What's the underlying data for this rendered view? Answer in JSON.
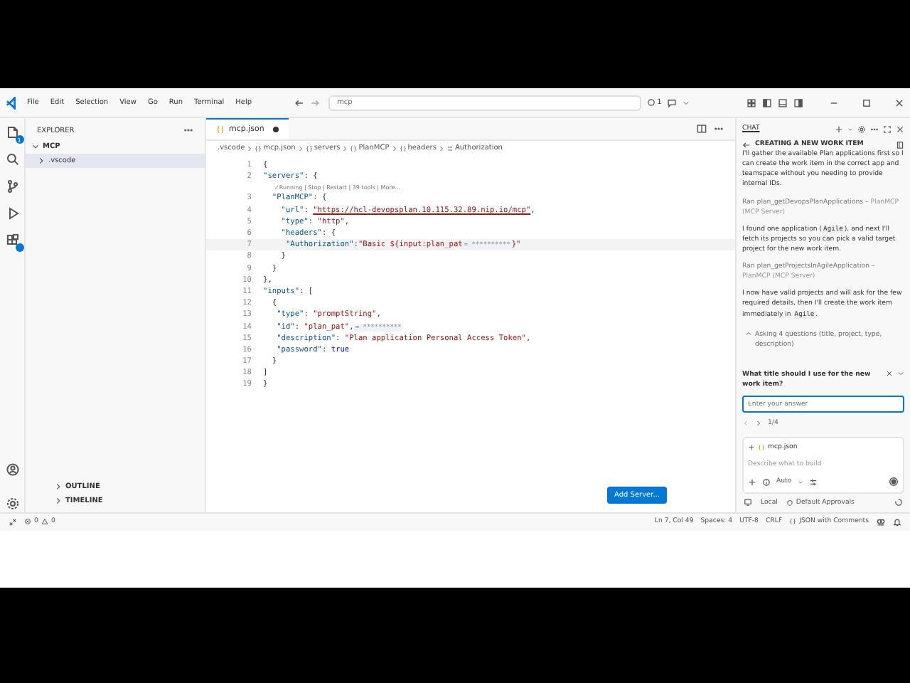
{
  "title_bar": {
    "menus": [
      "File",
      "Edit",
      "Selection",
      "View",
      "Go",
      "Run",
      "Terminal",
      "Help"
    ],
    "search": {
      "value": "mcp"
    },
    "counter": "1"
  },
  "activity_bar": {
    "explorer_badge": "1"
  },
  "sidebar": {
    "title": "EXPLORER",
    "folder": {
      "label": "MCP",
      "expanded": true,
      "children": [
        {
          "label": ".vscode",
          "expanded": false,
          "selected": true
        }
      ]
    },
    "sections": [
      {
        "label": "OUTLINE",
        "expanded": false
      },
      {
        "label": "TIMELINE",
        "expanded": false
      }
    ]
  },
  "editor": {
    "tabs": [
      {
        "label": "mcp.json",
        "modified": true,
        "selected": true
      }
    ],
    "breadcrumb": [
      ".vscode",
      "mcp.json",
      "servers",
      "PlanMCP",
      "headers",
      "Authorization"
    ],
    "lines": [
      {
        "kind": "code",
        "number": "1",
        "selected": false,
        "segments": [
          {
            "kind": "p",
            "text": "{"
          }
        ]
      },
      {
        "kind": "code",
        "number": "2",
        "selected": false,
        "segments": [
          {
            "kind": "k",
            "text": "\"servers\""
          },
          {
            "kind": "p",
            "text": ": {"
          }
        ]
      },
      {
        "kind": "lens",
        "text": "✓Running | Stop | Restart | 39 tools | More..."
      },
      {
        "kind": "code",
        "number": "3",
        "selected": false,
        "segments": [
          {
            "kind": "k",
            "text": "  \"PlanMCP\""
          },
          {
            "kind": "p",
            "text": ": {"
          }
        ]
      },
      {
        "kind": "code",
        "number": "4",
        "selected": false,
        "segments": [
          {
            "kind": "k",
            "text": "    \"url\""
          },
          {
            "kind": "p",
            "text": ": "
          },
          {
            "kind": "u",
            "text": "\"https://hcl-devopsplan.10.115.32.89.nip.io/mcp\""
          },
          {
            "kind": "p",
            "text": ","
          }
        ]
      },
      {
        "kind": "code",
        "number": "5",
        "selected": false,
        "segments": [
          {
            "kind": "k",
            "text": "    \"type\""
          },
          {
            "kind": "p",
            "text": ": "
          },
          {
            "kind": "s",
            "text": "\"http\""
          },
          {
            "kind": "p",
            "text": ","
          }
        ]
      },
      {
        "kind": "code",
        "number": "6",
        "selected": false,
        "segments": [
          {
            "kind": "k",
            "text": "    \"headers\""
          },
          {
            "kind": "p",
            "text": ": {"
          }
        ]
      },
      {
        "kind": "code",
        "number": "7",
        "selected": true,
        "segments": [
          {
            "kind": "k",
            "text": "     \"Authorization\""
          },
          {
            "kind": "p",
            "text": ":"
          },
          {
            "kind": "s",
            "text": "\"Basic ${input:plan_pat"
          },
          {
            "kind": "m",
            "text": "= **********"
          },
          {
            "kind": "s",
            "text": "}\""
          }
        ]
      },
      {
        "kind": "code",
        "number": "8",
        "selected": false,
        "segments": [
          {
            "kind": "p",
            "text": "    }"
          }
        ]
      },
      {
        "kind": "code",
        "number": "9",
        "selected": false,
        "segments": [
          {
            "kind": "p",
            "text": "  }"
          }
        ]
      },
      {
        "kind": "code",
        "number": "10",
        "selected": false,
        "segments": [
          {
            "kind": "p",
            "text": "},"
          }
        ]
      },
      {
        "kind": "code",
        "number": "11",
        "selected": false,
        "segments": [
          {
            "kind": "k",
            "text": "\"inputs\""
          },
          {
            "kind": "p",
            "text": ": ["
          }
        ]
      },
      {
        "kind": "code",
        "number": "12",
        "selected": false,
        "segments": [
          {
            "kind": "p",
            "text": "  {"
          }
        ]
      },
      {
        "kind": "code",
        "number": "13",
        "selected": false,
        "segments": [
          {
            "kind": "k",
            "text": "   \"type\""
          },
          {
            "kind": "p",
            "text": ": "
          },
          {
            "kind": "s",
            "text": "\"promptString\""
          },
          {
            "kind": "p",
            "text": ","
          }
        ]
      },
      {
        "kind": "code",
        "number": "14",
        "selected": false,
        "segments": [
          {
            "kind": "k",
            "text": "   \"id\""
          },
          {
            "kind": "p",
            "text": ": "
          },
          {
            "kind": "s",
            "text": "\"plan_pat\""
          },
          {
            "kind": "p",
            "text": ","
          },
          {
            "kind": "m",
            "text": "= **********"
          }
        ]
      },
      {
        "kind": "code",
        "number": "15",
        "selected": false,
        "segments": [
          {
            "kind": "k",
            "text": "   \"description\""
          },
          {
            "kind": "p",
            "text": ": "
          },
          {
            "kind": "s",
            "text": "\"Plan application Personal Access Token\""
          },
          {
            "kind": "p",
            "text": ","
          }
        ]
      },
      {
        "kind": "code",
        "number": "16",
        "selected": false,
        "segments": [
          {
            "kind": "k",
            "text": "   \"password\""
          },
          {
            "kind": "p",
            "text": ": "
          },
          {
            "kind": "b",
            "text": "true"
          }
        ]
      },
      {
        "kind": "code",
        "number": "17",
        "selected": false,
        "segments": [
          {
            "kind": "p",
            "text": "  }"
          }
        ]
      },
      {
        "kind": "code",
        "number": "18",
        "selected": false,
        "segments": [
          {
            "kind": "p",
            "text": "]"
          }
        ]
      },
      {
        "kind": "code",
        "number": "19",
        "selected": false,
        "segments": [
          {
            "kind": "p",
            "text": "}"
          }
        ]
      }
    ],
    "button": "Add Server..."
  },
  "chat": {
    "title": "CHAT",
    "session": "CREATING A NEW WORK ITEM",
    "messages": [
      {
        "kind": "text",
        "segments": [
          {
            "kind": "t",
            "text": "I'll gather the available Plan applications first so I can create the work item in the correct app and teamspace without you needing to provide internal IDs."
          }
        ]
      },
      {
        "kind": "tool",
        "action": "Ran plan_getDevopsPlanApplications –",
        "source": "PlanMCP (MCP Server)"
      },
      {
        "kind": "text",
        "segments": [
          {
            "kind": "t",
            "text": "I found one application ("
          },
          {
            "kind": "c",
            "text": "Agile"
          },
          {
            "kind": "t",
            "text": "), and next I'll fetch its projects so you can pick a valid target project for the new work item."
          }
        ]
      },
      {
        "kind": "tool",
        "action": "Ran plan_getProjectsInAgileApplication –",
        "source": "PlanMCP (MCP Server)"
      },
      {
        "kind": "text",
        "segments": [
          {
            "kind": "t",
            "text": "I now have valid projects and will ask for the few required details, then I'll create the work item immediately in "
          },
          {
            "kind": "c",
            "text": "Agile"
          },
          {
            "kind": "t",
            "text": "."
          }
        ]
      },
      {
        "kind": "group",
        "text": "Asking 4 questions (title, project, type, description)",
        "expanded": true
      }
    ],
    "question": {
      "text": "What title should I use for the new work item?",
      "placeholder": "Enter your answer",
      "page": "1/4"
    },
    "composer": {
      "attachment": "mcp.json",
      "placeholder": "Describe what to build",
      "mode": "Auto",
      "target": "Local",
      "approvals": "Default Approvals"
    }
  },
  "status_bar": {
    "errors": "0",
    "warnings": "0",
    "items": [
      "Ln 7, Col 49",
      "Spaces: 4",
      "UTF-8",
      "CRLF",
      "JSON with Comments"
    ]
  }
}
